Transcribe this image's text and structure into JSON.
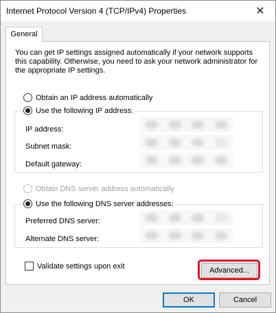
{
  "window": {
    "title": "Internet Protocol Version 4 (TCP/IPv4) Properties",
    "close_glyph": "✕"
  },
  "tabs": [
    {
      "label": "General"
    }
  ],
  "general": {
    "description": "You can get IP settings assigned automatically if your network supports this capability. Otherwise, you need to ask your network administrator for the appropriate IP settings.",
    "ip_mode": {
      "auto_label": "Obtain an IP address automatically",
      "manual_label": "Use the following IP address:",
      "selected": "manual"
    },
    "ip_fields": [
      {
        "label": "IP address:"
      },
      {
        "label": "Subnet mask:"
      },
      {
        "label": "Default gateway:"
      }
    ],
    "dns_mode": {
      "auto_label": "Obtain DNS server address automatically",
      "manual_label": "Use the following DNS server addresses:",
      "selected": "manual"
    },
    "dns_fields": [
      {
        "label": "Preferred DNS server:"
      },
      {
        "label": "Alternate DNS server:"
      }
    ],
    "validate_label": "Validate settings upon exit",
    "advanced_label": "Advanced..."
  },
  "footer": {
    "ok_label": "OK",
    "cancel_label": "Cancel"
  },
  "colors": {
    "highlight": "#e81123",
    "default_button_border": "#0078d7"
  },
  "icons": {
    "close": "close-icon"
  }
}
